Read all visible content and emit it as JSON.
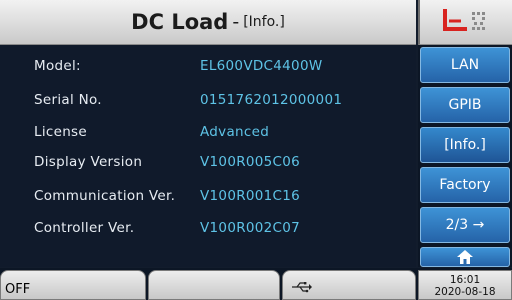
{
  "header": {
    "title": "DC Load",
    "separator": "-",
    "subtitle": "[Info.]"
  },
  "info": [
    {
      "label": "Model:",
      "value": "EL600VDC4400W"
    },
    {
      "label": "Serial No.",
      "value": "0151762012000001"
    },
    {
      "label": "License",
      "value": "Advanced"
    },
    {
      "label": "Display Version",
      "value": "V100R005C06"
    },
    {
      "label": "Communication Ver.",
      "value": "V100R001C16"
    },
    {
      "label": "Controller Ver.",
      "value": "V100R002C07"
    }
  ],
  "sidebar": {
    "buttons": [
      "LAN",
      "GPIB",
      "[Info.]",
      "Factory",
      "2/3 →"
    ],
    "home_icon": "home-icon"
  },
  "status": {
    "output": "OFF",
    "usb_icon": "usb-icon",
    "time": "16:01",
    "date": "2020-08-18"
  },
  "logo": {
    "icon": "brand-logo",
    "colors": {
      "red": "#d8231f",
      "gray": "#8a8a8a"
    }
  },
  "colors": {
    "background": "#101a2b",
    "label": "#e7ecf2",
    "value": "#5ec3e6",
    "button": "#2f79bf"
  }
}
